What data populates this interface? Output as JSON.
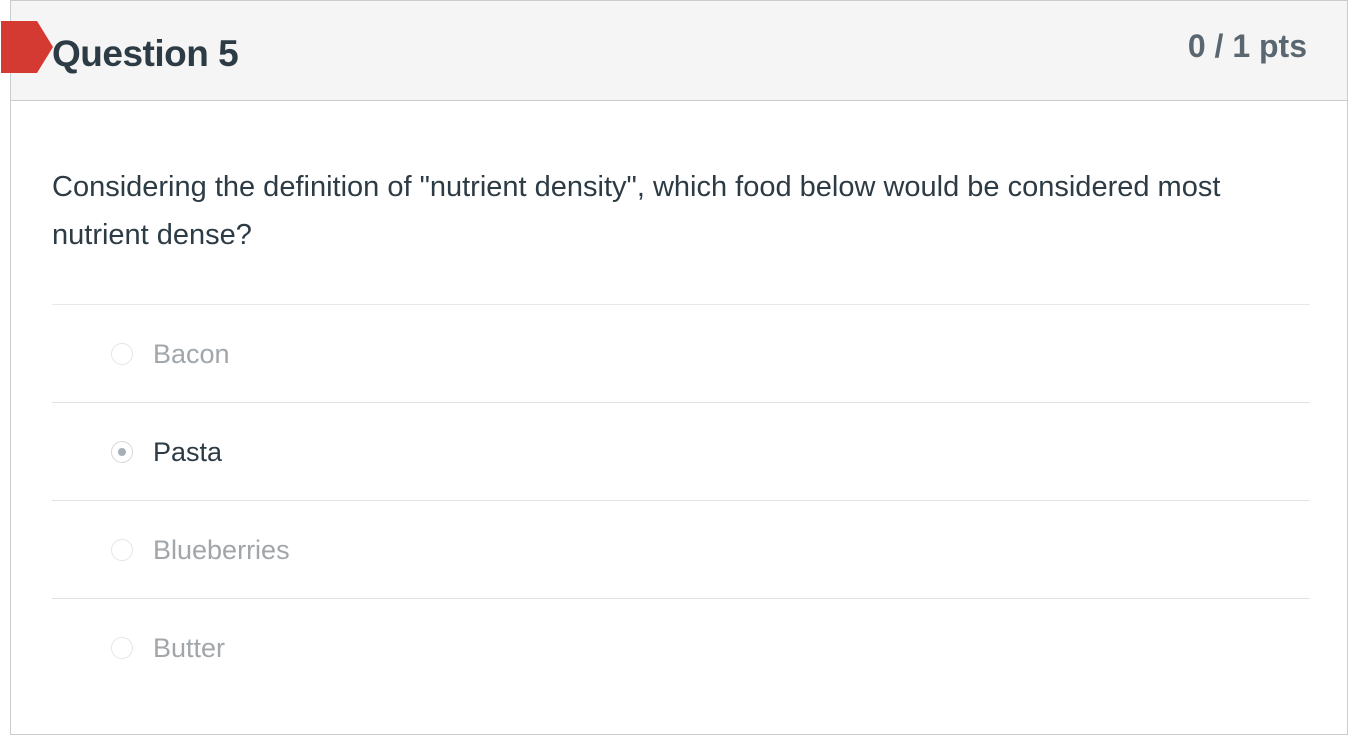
{
  "question": {
    "title": "Question 5",
    "points": "0 / 1 pts",
    "status": "incorrect",
    "flag_color": "#d53a32",
    "text": "Considering the definition of \"nutrient density\", which food below would be considered most nutrient dense?"
  },
  "answers": [
    {
      "label": "Bacon",
      "selected": false
    },
    {
      "label": "Pasta",
      "selected": true
    },
    {
      "label": "Blueberries",
      "selected": false
    },
    {
      "label": "Butter",
      "selected": false
    }
  ]
}
